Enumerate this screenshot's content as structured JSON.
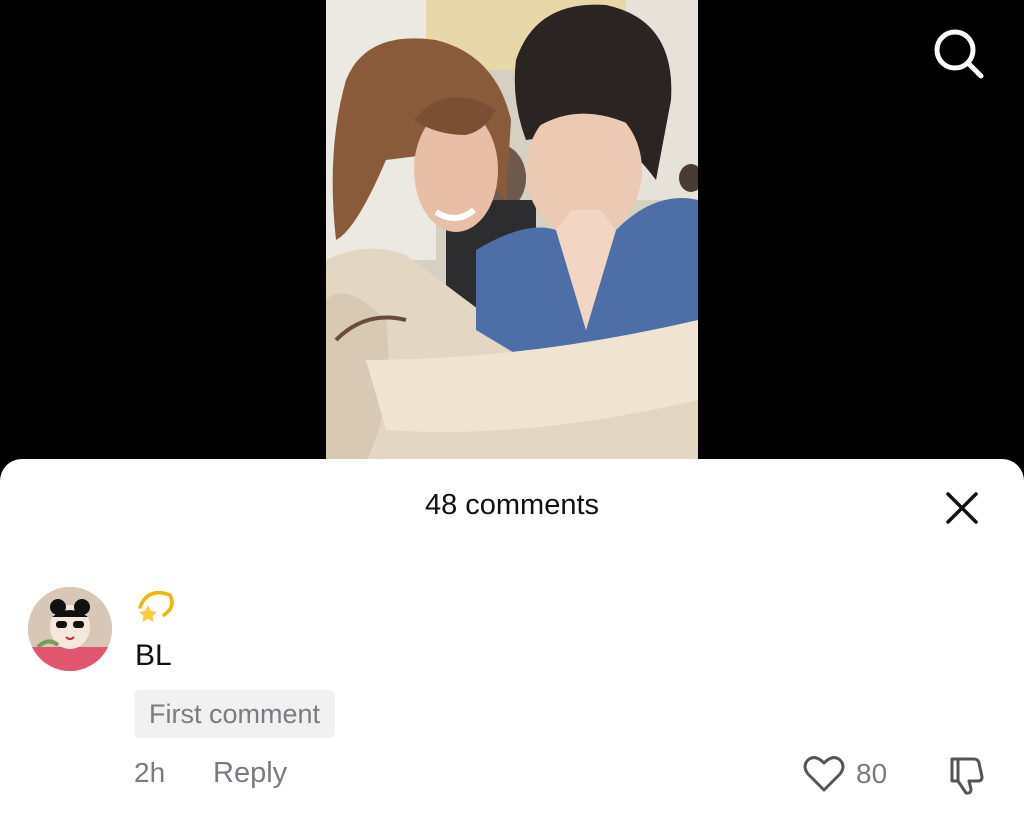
{
  "video": {
    "search_icon": "search-icon"
  },
  "comments_sheet": {
    "title": "48 comments",
    "close_icon": "close-icon"
  },
  "comment": {
    "avatar_icon": "avatar",
    "emoji_icon": "dizzy-star-emoji",
    "username": "BL",
    "badge": "First comment",
    "time": "2h",
    "reply_label": "Reply",
    "like_count": "80",
    "like_icon": "heart-icon",
    "dislike_icon": "thumbs-down-icon"
  }
}
